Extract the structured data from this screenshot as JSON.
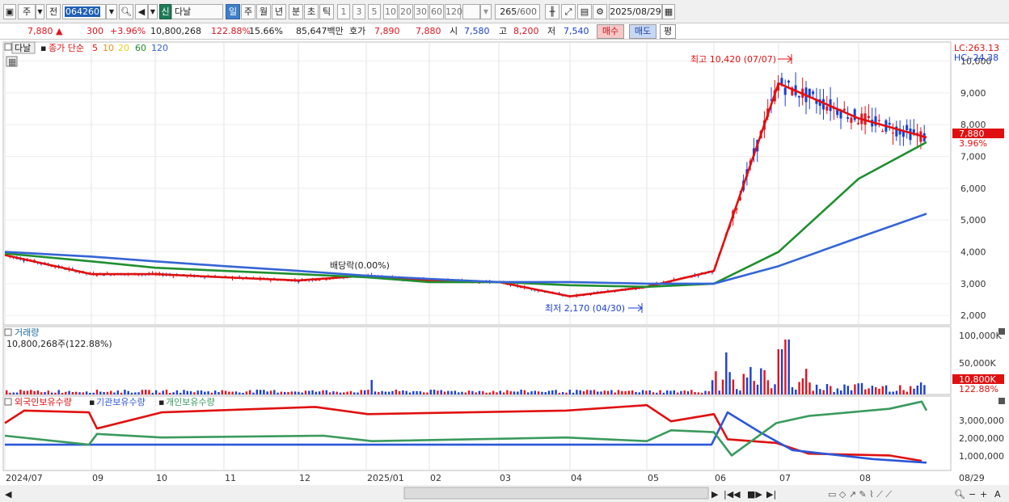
{
  "toolbar": {
    "market": "주",
    "jeon": "전",
    "code": "064260",
    "sin_badge": "신",
    "name": "다날",
    "periods": [
      "일",
      "주",
      "월",
      "년",
      "분",
      "초",
      "틱"
    ],
    "active_period": "일",
    "intervals": [
      "1",
      "3",
      "5",
      "10",
      "20",
      "30",
      "60",
      "120"
    ],
    "count": "265",
    "count_total": "/600",
    "date": "2025/08/29"
  },
  "quote": {
    "price": "7,880",
    "change_arrow": "▲",
    "change": "300",
    "change_pct": "+3.96%",
    "volume": "10,800,268",
    "volume_ratio": "122.88%",
    "turnover": "15.66%",
    "amount": "85,647백만",
    "hoga_label": "호가",
    "ask": "7,890",
    "bid": "7,880",
    "open_label": "시",
    "open": "7,580",
    "high_label": "고",
    "high": "8,200",
    "low_label": "저",
    "low": "7,540",
    "buy_button": "매수",
    "sell_button": "매도",
    "eval_button": "평"
  },
  "price_panel": {
    "name_tag": "다날",
    "ma_title": "종가 단순",
    "ma_periods": [
      "5",
      "10",
      "20",
      "60",
      "120"
    ],
    "lc_label": "LC:263.13",
    "hc_label": "HC:-24.38",
    "last_price_tag": "7,880",
    "last_pct_tag": "3.96%",
    "high_annotation": "최고 10,420 (07/07)",
    "low_annotation": "최저 2,170 (04/30)",
    "dividend_annotation": "배당락(0.00%)",
    "y_ticks": [
      "10,000",
      "9,000",
      "8,000",
      "7,000",
      "6,000",
      "5,000",
      "4,000",
      "3,000",
      "2,000"
    ]
  },
  "volume_panel": {
    "title": "거래량",
    "value": "10,800,268주(122.88%)",
    "y_ticks": [
      "100,000K",
      "50,000K"
    ],
    "last_tag": "10,800K",
    "last_pct": "122.88%"
  },
  "holdings_panel": {
    "series": [
      "외국인보유수량",
      "기관보유수량",
      "개인보유수량"
    ],
    "y_ticks": [
      "3,000,000",
      "2,000,000",
      "1,000,000"
    ]
  },
  "x_axis": {
    "labels": [
      "2024/07",
      "09",
      "10",
      "11",
      "12",
      "2025/01",
      "02",
      "03",
      "04",
      "05",
      "06",
      "07",
      "08"
    ],
    "end_label": "08/29"
  },
  "colors": {
    "up": "#e0141e",
    "down": "#1b3fd1",
    "ma5": "#e01010",
    "ma10": "#f08c1e",
    "ma20": "#f5f52a",
    "ma60": "#1f8f2f",
    "ma120": "#3565d6",
    "foreign": "#e01010",
    "institution": "#2b57d8",
    "individual": "#3a9a5e"
  },
  "chart_data": {
    "type": "line",
    "title": "다날 (064260)",
    "x_range": [
      "2024/07",
      "2025/08/29"
    ],
    "ylim": [
      2000,
      10420
    ],
    "series": [
      {
        "name": "5",
        "x": [
          "2024/07",
          "2024/09",
          "2024/10",
          "2024/11",
          "2024/12",
          "2025/01",
          "2025/02",
          "2025/03",
          "2025/04",
          "2025/05",
          "2025/06",
          "2025/07",
          "2025/08",
          "2025/08/29"
        ],
        "values": [
          3900,
          3300,
          3300,
          3200,
          3100,
          3250,
          3100,
          3050,
          2600,
          2900,
          3400,
          9300,
          8200,
          7600
        ]
      },
      {
        "name": "60",
        "x": [
          "2024/07",
          "2024/09",
          "2024/10",
          "2024/11",
          "2024/12",
          "2025/01",
          "2025/02",
          "2025/03",
          "2025/04",
          "2025/05",
          "2025/06",
          "2025/07",
          "2025/08",
          "2025/08/29"
        ],
        "values": [
          3950,
          3700,
          3500,
          3400,
          3300,
          3200,
          3050,
          3050,
          2950,
          2900,
          3000,
          4000,
          6300,
          7450
        ]
      },
      {
        "name": "120",
        "x": [
          "2024/07",
          "2024/09",
          "2024/10",
          "2024/11",
          "2024/12",
          "2025/01",
          "2025/02",
          "2025/03",
          "2025/04",
          "2025/05",
          "2025/06",
          "2025/07",
          "2025/08",
          "2025/08/29"
        ],
        "values": [
          4000,
          3850,
          3700,
          3550,
          3400,
          3250,
          3150,
          3050,
          3050,
          3000,
          3000,
          3550,
          4450,
          5200
        ]
      }
    ],
    "annotations": [
      {
        "label": "최고 10,420 (07/07)",
        "x": "2025/07/07",
        "y": 10420
      },
      {
        "label": "최저 2,170 (04/30)",
        "x": "2025/04/30",
        "y": 2170
      }
    ]
  }
}
